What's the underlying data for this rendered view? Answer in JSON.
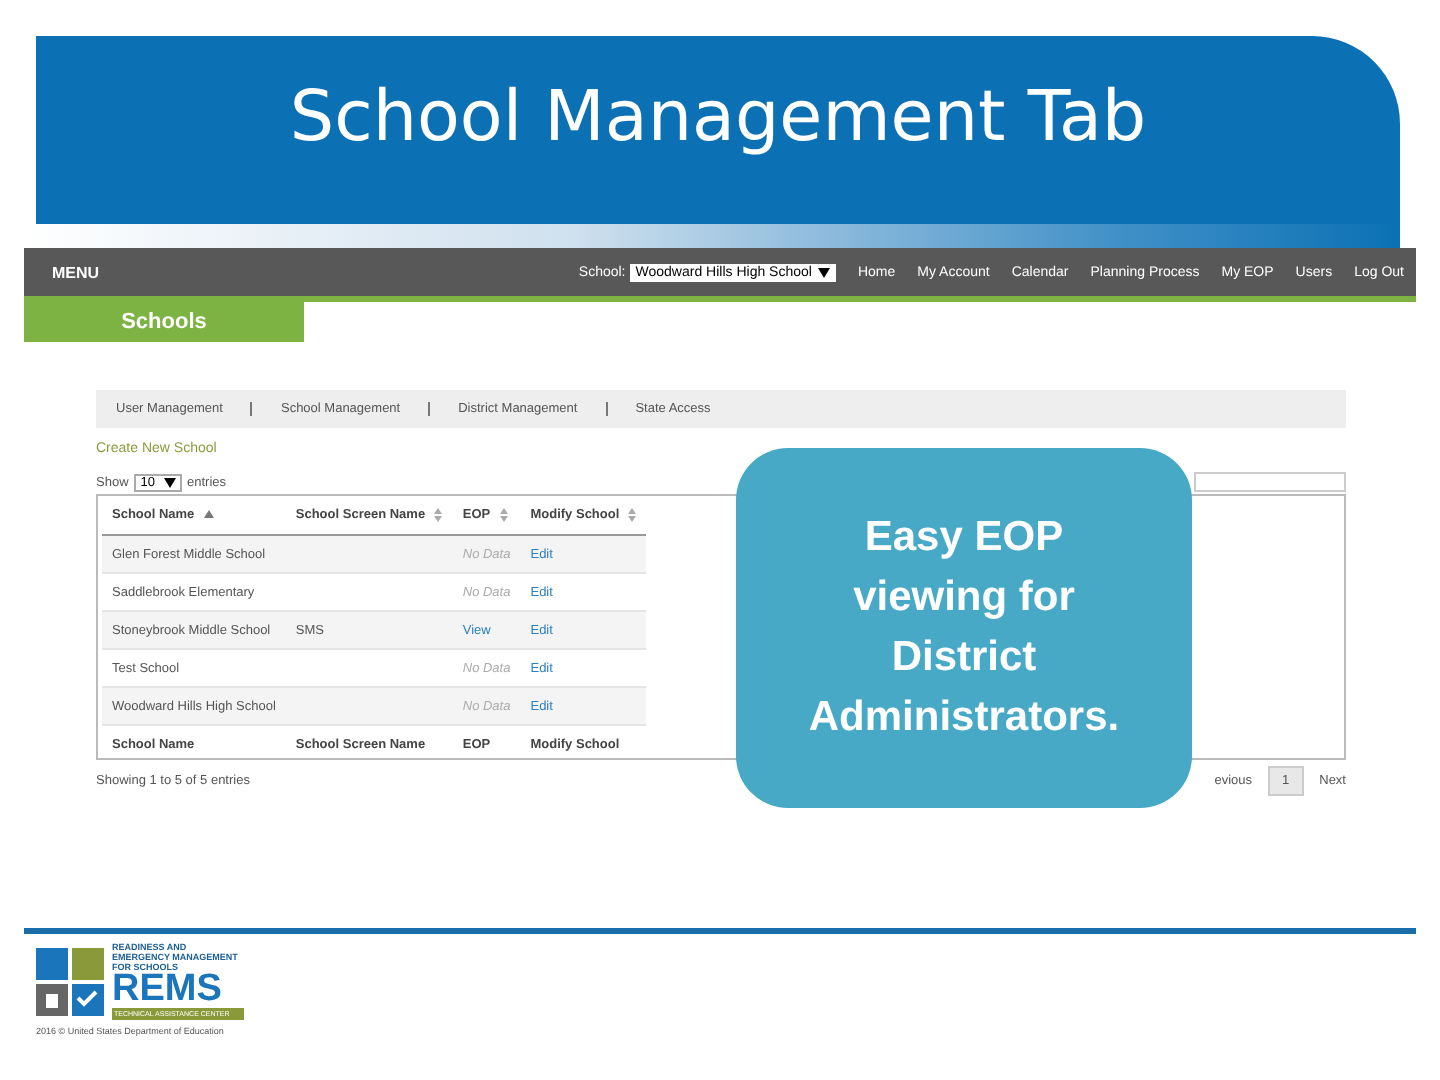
{
  "slide_title": "School Management Tab",
  "menu_bar": {
    "menu_label": "MENU",
    "school_label": "School:",
    "school_select": {
      "value": "Woodward Hills High School"
    },
    "links": [
      "Home",
      "My Account",
      "Calendar",
      "Planning Process",
      "My EOP",
      "Users",
      "Log Out"
    ]
  },
  "page_tab": {
    "label": "Schools",
    "selected": true
  },
  "sub_nav": [
    "User Management",
    "School Management",
    "District Management",
    "State Access"
  ],
  "create_link": "Create New School",
  "show_entries": {
    "prefix": "Show",
    "value": "10",
    "suffix": "entries"
  },
  "table": {
    "columns": [
      {
        "label": "School Name",
        "sorted": true
      },
      {
        "label": "School Screen Name",
        "sorted": false
      },
      {
        "label": "EOP",
        "sorted": false
      },
      {
        "label": "Modify School",
        "sorted": false
      }
    ],
    "rows": [
      {
        "name": "Glen Forest Middle School",
        "screen_name": "",
        "eop": {
          "kind": "none",
          "text": "No Data"
        },
        "modify": "Edit"
      },
      {
        "name": "Saddlebrook Elementary",
        "screen_name": "",
        "eop": {
          "kind": "none",
          "text": "No Data"
        },
        "modify": "Edit"
      },
      {
        "name": "Stoneybrook Middle School",
        "screen_name": "SMS",
        "eop": {
          "kind": "link",
          "text": "View"
        },
        "modify": "Edit"
      },
      {
        "name": "Test School",
        "screen_name": "",
        "eop": {
          "kind": "none",
          "text": "No Data"
        },
        "modify": "Edit"
      },
      {
        "name": "Woodward Hills High School",
        "screen_name": "",
        "eop": {
          "kind": "none",
          "text": "No Data"
        },
        "modify": "Edit"
      }
    ],
    "footer": [
      "School Name",
      "School Screen Name",
      "EOP",
      "Modify School"
    ]
  },
  "info": "Showing 1 to 5 of 5 entries",
  "pagination": {
    "previous": "evious",
    "pages": [
      {
        "label": "1",
        "selected": true
      }
    ],
    "next": "Next"
  },
  "callout": "Easy EOP viewing for District Administrators.",
  "footer": {
    "logo_tagline": "READINESS AND EMERGENCY MANAGEMENT FOR SCHOOLS",
    "logo_name": "REMS",
    "logo_subtitle": "TECHNICAL ASSISTANCE CENTER",
    "copyright": "2016 © United States Department of Education"
  }
}
